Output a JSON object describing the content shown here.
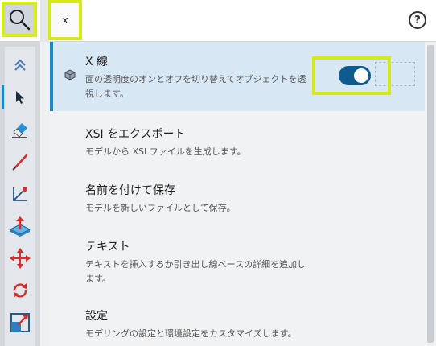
{
  "search": {
    "value": "x",
    "icon": "search-icon"
  },
  "help": {
    "label": "?"
  },
  "toolbar": {
    "tools": [
      {
        "name": "collapse-up-icon"
      },
      {
        "name": "select-arrow-icon"
      },
      {
        "name": "eraser-icon"
      },
      {
        "name": "pencil-icon"
      },
      {
        "name": "line-icon"
      },
      {
        "name": "push-pull-icon"
      },
      {
        "name": "move-icon"
      },
      {
        "name": "rotate-icon"
      },
      {
        "name": "scale-icon"
      }
    ]
  },
  "menu": {
    "items": [
      {
        "title": "X 線",
        "desc_line1": "面の透明度のオンとオフを切り替えてオブジェクトを透",
        "desc_line2": "視します。",
        "toggle_on": true
      },
      {
        "title": "XSI をエクスポート",
        "desc_line1": "モデルから XSI ファイルを生成します。"
      },
      {
        "title": "名前を付けて保存",
        "desc_line1": "モデルを新しいファイルとして保存。"
      },
      {
        "title": "テキスト",
        "desc_line1": "テキストを挿入するか引き出し線ベースの詳細を追加し",
        "desc_line2": "ます。"
      },
      {
        "title": "設定",
        "desc_line1": "モデリングの設定と環境設定をカスタマイズします。"
      }
    ]
  },
  "colors": {
    "highlight": "#d6ea16",
    "accent": "#1e88c7",
    "toggle_on": "#0f5a8e"
  }
}
